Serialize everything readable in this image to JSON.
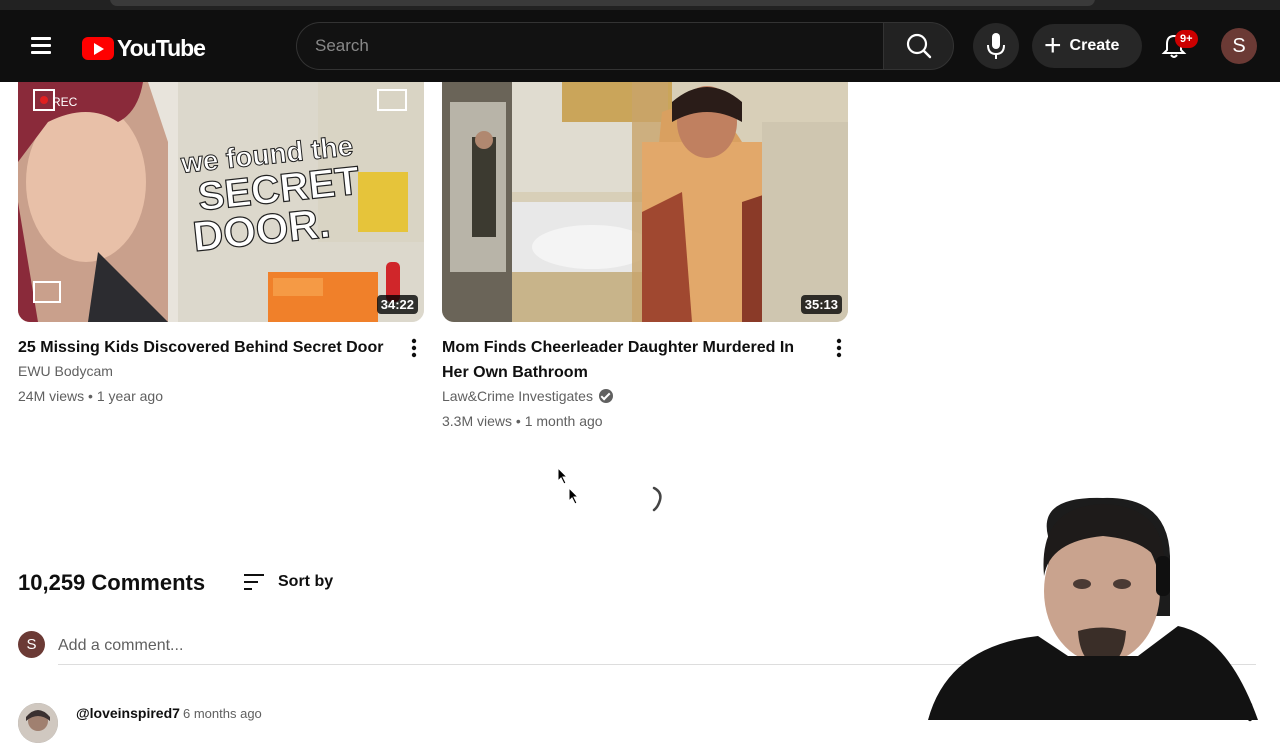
{
  "header": {
    "logo_text": "YouTube",
    "search_placeholder": "Search",
    "create_label": "Create",
    "notification_count": "9+",
    "avatar_initial": "S"
  },
  "videos": [
    {
      "title": "25 Missing Kids Discovered Behind Secret Door",
      "channel": "EWU Bodycam",
      "views": "24M views",
      "age": "1 year ago",
      "duration": "34:22",
      "thumb_text_line1": "we found the",
      "thumb_text_line2": "SECRET",
      "thumb_text_line3": "DOOR.",
      "thumb_rec": "REC"
    },
    {
      "title": "Mom Finds Cheerleader Daughter Murdered In Her Own Bathroom",
      "channel": "Law&Crime Investigates",
      "verified": true,
      "views": "3.3M views",
      "age": "1 month ago",
      "duration": "35:13"
    }
  ],
  "comments": {
    "count_label": "10,259 Comments",
    "sort_label": "Sort by",
    "user_initial": "S",
    "add_placeholder": "Add a comment...",
    "first": {
      "author": "@loveinspired7",
      "time": "6 months ago"
    }
  },
  "colors": {
    "brand_red": "#ff0000",
    "masthead": "#0f0f0f",
    "badge": "#cc0000",
    "avatar": "#6b3a35"
  }
}
